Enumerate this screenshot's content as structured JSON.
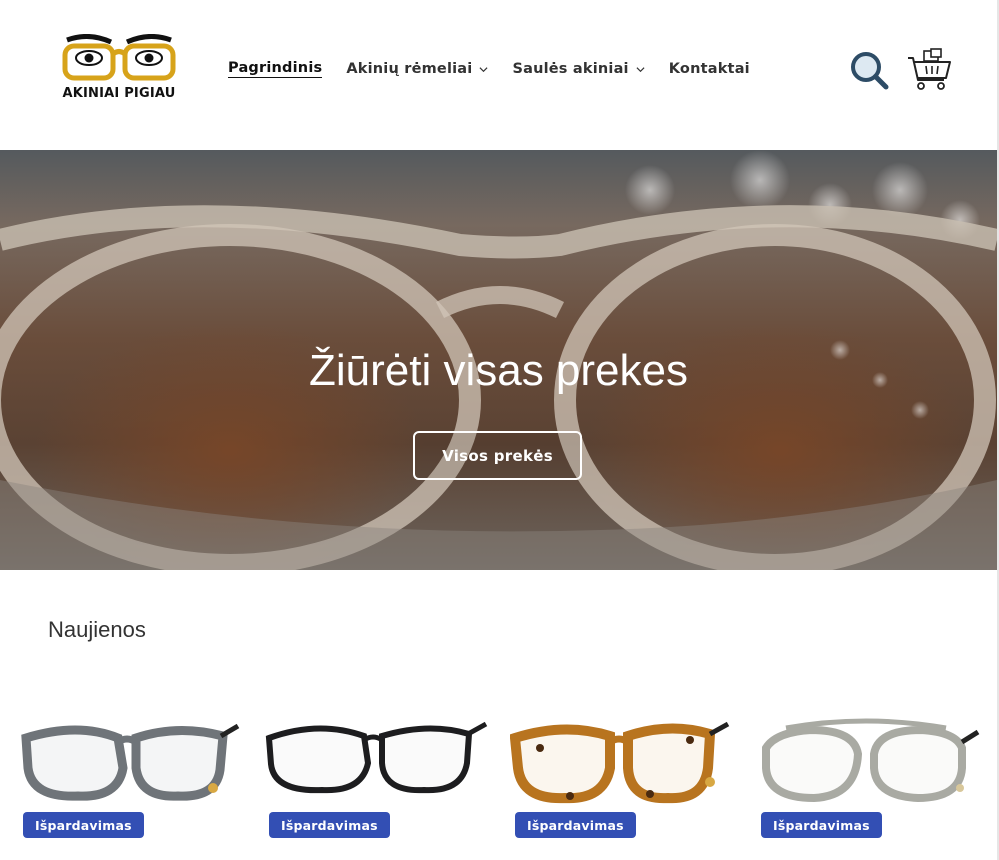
{
  "logo": {
    "text": "AKINIAI PIGIAU"
  },
  "nav": {
    "items": [
      {
        "label": "Pagrindinis",
        "active": true,
        "dropdown": false
      },
      {
        "label": "Akinių rėmeliai",
        "active": false,
        "dropdown": true
      },
      {
        "label": "Saulės akiniai",
        "active": false,
        "dropdown": true
      },
      {
        "label": "Kontaktai",
        "active": false,
        "dropdown": false
      }
    ]
  },
  "hero": {
    "title": "Žiūrėti visas prekes",
    "button_label": "Visos prekės"
  },
  "collection": {
    "title": "Naujienos",
    "products": [
      {
        "badge": "Išpardavimas",
        "frame_color": "#6f7479"
      },
      {
        "badge": "Išpardavimas",
        "frame_color": "#1d1d1f"
      },
      {
        "badge": "Išpardavimas",
        "frame_color": "#b8741f"
      },
      {
        "badge": "Išpardavimas",
        "frame_color": "#a9aaa3"
      }
    ]
  },
  "colors": {
    "badge": "#334fb4",
    "logo_gold": "#d7a31a"
  }
}
